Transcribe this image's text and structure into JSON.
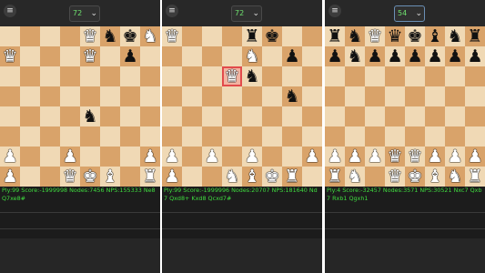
{
  "panels": [
    {
      "menu_icon": "menu-icon",
      "depth": "72",
      "depth_active": false,
      "board": [
        "....QnkN",
        "Q...Q.p.",
        "........",
        "........",
        "....n...",
        "........",
        "P..P...P",
        "P..QKB.R"
      ],
      "highlight": [],
      "status": "Ply:99 Score:-1999998 Nodes:7456 NPS:155333 Ne8 Q7xe8#"
    },
    {
      "menu_icon": "menu-icon",
      "depth": "72",
      "depth_active": false,
      "board": [
        "Q...rk..",
        "....N.p.",
        "...Qn..",
        "......n.",
        "........",
        "........",
        "P.P.P..P",
        "P..NBKR."
      ],
      "highlight": [
        [
          2,
          3
        ]
      ],
      "status": "Ply:99 Score:-1999996 Nodes:20707 NPS:181640 Nd7 Qxd8+ Kxd8 Qcxd7#"
    },
    {
      "menu_icon": "menu-icon",
      "depth": "54",
      "depth_active": true,
      "board": [
        "rnQqkbnr",
        "pnpppppp",
        "........",
        "........",
        "........",
        "........",
        "PPPQQPPP",
        "RN.QKBNR"
      ],
      "highlight": [],
      "status": "Ply:4 Score:-32457 Nodes:3571 NPS:30521 Nxc7 Qxb7 Rxb1 Qgxh1"
    }
  ],
  "colors": {
    "light_square": "#f0d9b5",
    "dark_square": "#d9a36a",
    "status_text": "#3fdc3f",
    "highlight": "#e24b4b"
  }
}
